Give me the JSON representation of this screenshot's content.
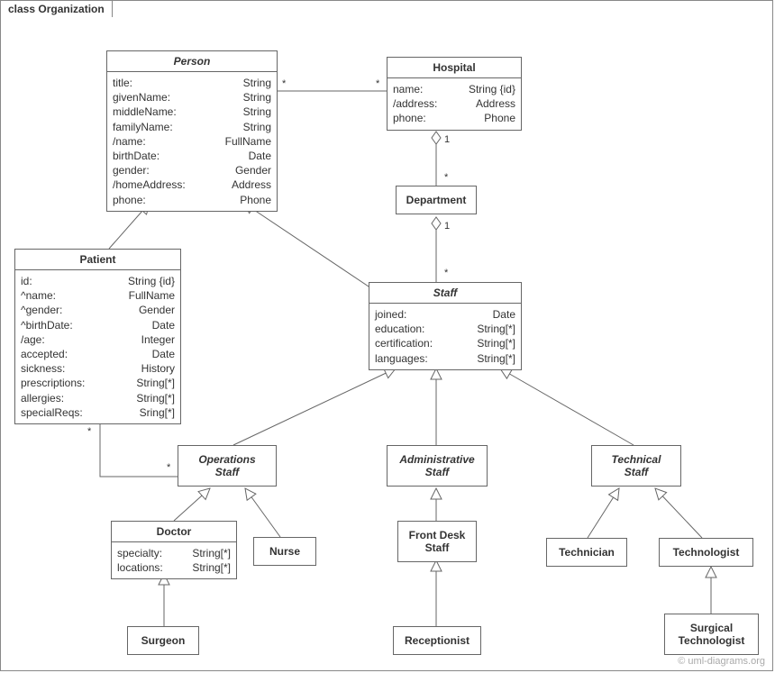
{
  "frame_label": "class Organization",
  "watermark": "© uml-diagrams.org",
  "classes": {
    "person": {
      "title": "Person",
      "attrs": [
        {
          "name": "title:",
          "type": "String"
        },
        {
          "name": "givenName:",
          "type": "String"
        },
        {
          "name": "middleName:",
          "type": "String"
        },
        {
          "name": "familyName:",
          "type": "String"
        },
        {
          "name": "/name:",
          "type": "FullName"
        },
        {
          "name": "birthDate:",
          "type": "Date"
        },
        {
          "name": "gender:",
          "type": "Gender"
        },
        {
          "name": "/homeAddress:",
          "type": "Address"
        },
        {
          "name": "phone:",
          "type": "Phone"
        }
      ]
    },
    "hospital": {
      "title": "Hospital",
      "attrs": [
        {
          "name": "name:",
          "type": "String {id}"
        },
        {
          "name": "/address:",
          "type": "Address"
        },
        {
          "name": "phone:",
          "type": "Phone"
        }
      ]
    },
    "department": {
      "title": "Department"
    },
    "patient": {
      "title": "Patient",
      "attrs": [
        {
          "name": "id:",
          "type": "String {id}"
        },
        {
          "name": "^name:",
          "type": "FullName"
        },
        {
          "name": "^gender:",
          "type": "Gender"
        },
        {
          "name": "^birthDate:",
          "type": "Date"
        },
        {
          "name": "/age:",
          "type": "Integer"
        },
        {
          "name": "accepted:",
          "type": "Date"
        },
        {
          "name": "sickness:",
          "type": "History"
        },
        {
          "name": "prescriptions:",
          "type": "String[*]"
        },
        {
          "name": "allergies:",
          "type": "String[*]"
        },
        {
          "name": "specialReqs:",
          "type": "Sring[*]"
        }
      ]
    },
    "staff": {
      "title": "Staff",
      "attrs": [
        {
          "name": "joined:",
          "type": "Date"
        },
        {
          "name": "education:",
          "type": "String[*]"
        },
        {
          "name": "certification:",
          "type": "String[*]"
        },
        {
          "name": "languages:",
          "type": "String[*]"
        }
      ]
    },
    "op_staff": {
      "title": "Operations",
      "title2": "Staff"
    },
    "admin_staff": {
      "title": "Administrative",
      "title2": "Staff"
    },
    "tech_staff": {
      "title": "Technical",
      "title2": "Staff"
    },
    "doctor": {
      "title": "Doctor",
      "attrs": [
        {
          "name": "specialty:",
          "type": "String[*]"
        },
        {
          "name": "locations:",
          "type": "String[*]"
        }
      ]
    },
    "nurse": {
      "title": "Nurse"
    },
    "frontdesk": {
      "title": "Front Desk",
      "title2": "Staff"
    },
    "technician": {
      "title": "Technician"
    },
    "technologist": {
      "title": "Technologist"
    },
    "surgeon": {
      "title": "Surgeon"
    },
    "receptionist": {
      "title": "Receptionist"
    },
    "surg_tech": {
      "title": "Surgical",
      "title2": "Technologist"
    }
  },
  "multiplicities": {
    "person_hosp_left": "*",
    "person_hosp_right": "*",
    "hosp_dept_top": "1",
    "hosp_dept_bottom": "*",
    "dept_staff_top": "1",
    "dept_staff_bottom": "*",
    "patient_opstaff_left": "*",
    "patient_opstaff_right": "*"
  }
}
